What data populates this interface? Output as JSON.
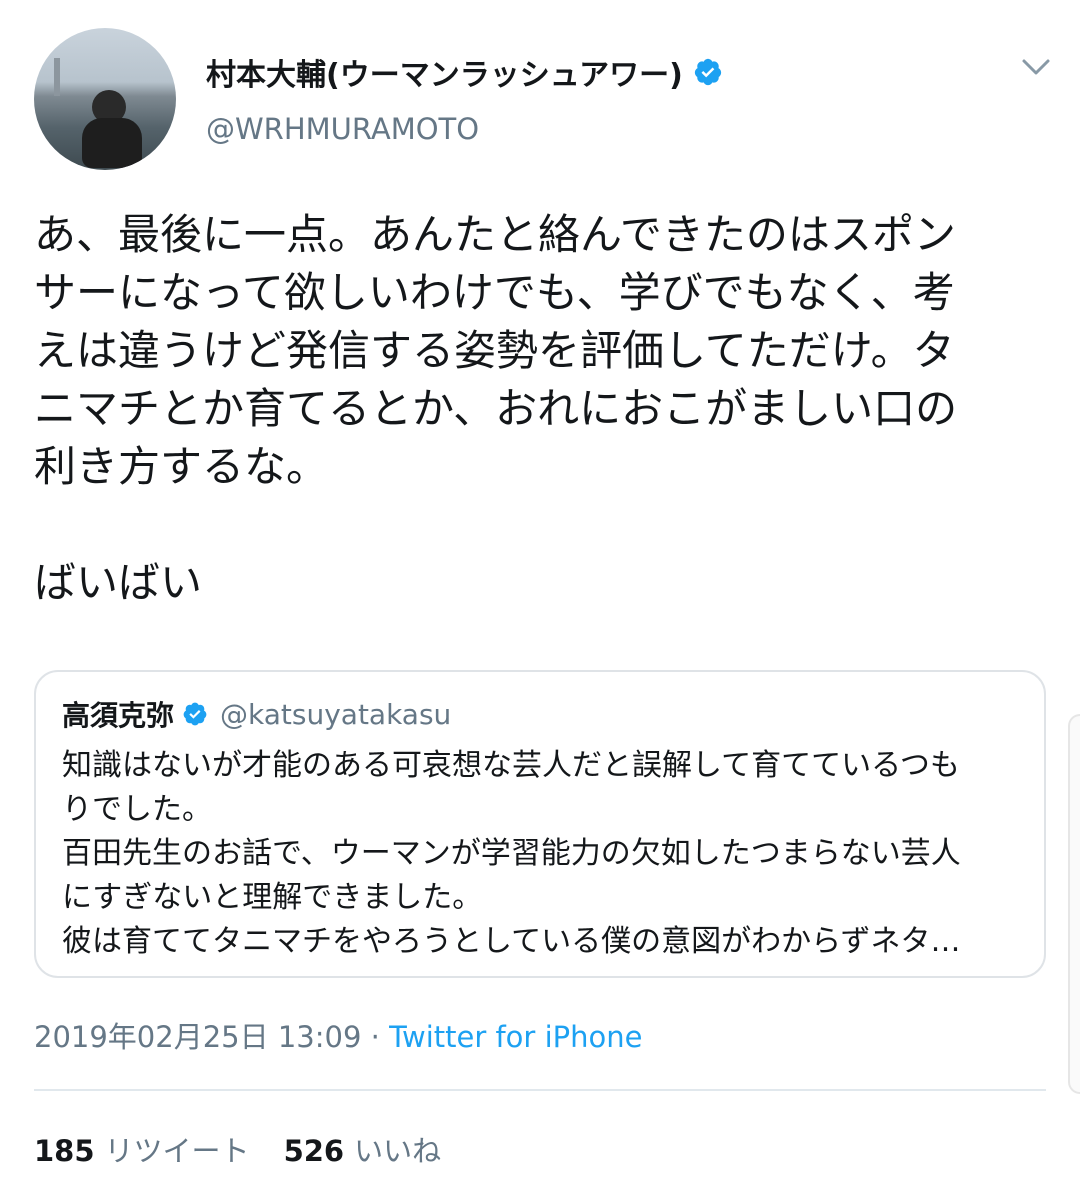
{
  "author": {
    "display_name": "村本大輔(ウーマンラッシュアワー)",
    "handle": "@WRHMURAMOTO",
    "verified": true
  },
  "tweet": {
    "text": "あ、最後に一点。あんたと絡んできたのはスポン\nサーになって欲しいわけでも、学びでもなく、考\nえは違うけど発信する姿勢を評価してただけ。タ\nニマチとか育てるとか、おれにおこがましい口の\n利き方するな。\n\nばいばい"
  },
  "quoted_tweet": {
    "display_name": "高須克弥",
    "handle": "@katsuyatakasu",
    "verified": true,
    "text": "知識はないが才能のある可哀想な芸人だと誤解して育てているつも\nりでした。\n百田先生のお話で、ウーマンが学習能力の欠如したつまらない芸人\nにすぎないと理解できました。\n彼は育ててタニマチをやろうとしている僕の意図がわからずネタ…"
  },
  "meta": {
    "date": "2019年02月25日 13:09",
    "separator": " · ",
    "source": "Twitter for iPhone"
  },
  "stats": {
    "retweets_count": "185",
    "retweets_label": "リツイート",
    "likes_count": "526",
    "likes_label": "いいね"
  },
  "colors": {
    "link_blue": "#1da1f2",
    "verified_blue": "#1da1f2",
    "secondary_text": "#657786",
    "primary_text": "#14171a",
    "border": "#dfe3e7"
  },
  "icons": {
    "verified": "verified-badge-icon",
    "chevron": "chevron-down-icon"
  }
}
